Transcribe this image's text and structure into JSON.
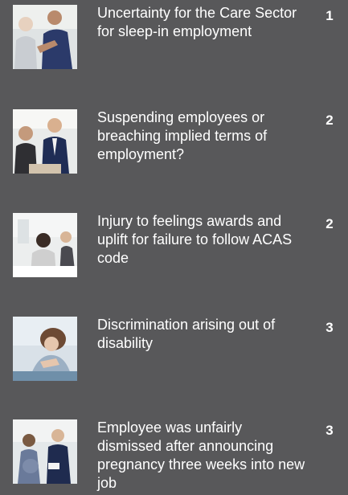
{
  "entries": [
    {
      "title": "Uncertainty for the Care Sector for sleep-in employment",
      "page": "1",
      "image": "carer-helping-elderly-man-photo"
    },
    {
      "title": "Suspending employees or breaching implied terms of employment?",
      "page": "2",
      "image": "office-meeting-photo"
    },
    {
      "title": "Injury to feelings awards and uplift for failure to follow ACAS code",
      "page": "2",
      "image": "distressed-employee-photo"
    },
    {
      "title": "Discrimination arising out of disability",
      "page": "3",
      "image": "upset-woman-photo"
    },
    {
      "title": "Employee was unfairly dismissed after announcing pregnancy three weeks into new job",
      "page": "3",
      "image": "pregnant-employee-photo"
    }
  ]
}
